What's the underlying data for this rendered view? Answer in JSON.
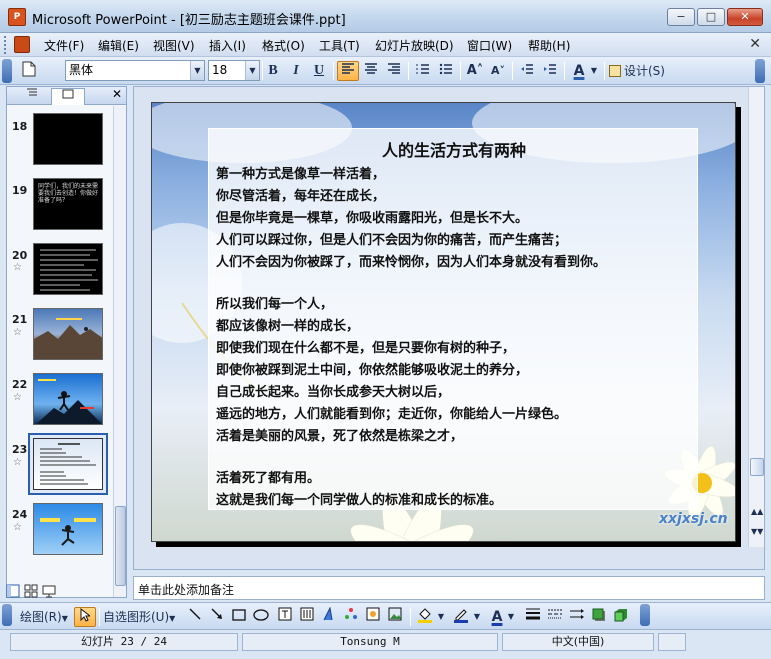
{
  "window": {
    "title": "Microsoft PowerPoint - [初三励志主题班会课件.ppt]",
    "app_icon": "P",
    "controls": {
      "minimize": "−",
      "maximize": "□",
      "close": "✕"
    }
  },
  "menu": {
    "items": [
      "文件(F)",
      "编辑(E)",
      "视图(V)",
      "插入(I)",
      "格式(O)",
      "工具(T)",
      "幻灯片放映(D)",
      "窗口(W)",
      "帮助(H)"
    ],
    "close_doc": "✕"
  },
  "toolbar": {
    "font_name": "黑体",
    "font_size": "18",
    "bold": "B",
    "italic": "I",
    "underline": "U",
    "grow_font": "A˄",
    "shrink_font": "A˅",
    "font_color": "A",
    "design_label": "设计(S)"
  },
  "colors": {
    "accent": "#2a5fb0",
    "active_button": "#ffb347",
    "slide_sky": "#5a86c8"
  },
  "icons": {
    "new": "new-file-icon",
    "align_left": "align-left-icon",
    "align_center": "align-center-icon",
    "align_right": "align-right-icon"
  },
  "left_panel": {
    "tab_outline_icon": "outline-tab-icon",
    "tab_slides_icon": "slides-tab-icon",
    "close": "✕",
    "thumbnails": [
      {
        "num": "18",
        "star": false,
        "style": "black",
        "text": ""
      },
      {
        "num": "19",
        "star": false,
        "style": "black",
        "text": "同学们，我们的未来需要我们去创造！你做好准备了吗？"
      },
      {
        "num": "20",
        "star": true,
        "style": "black-text",
        "text": ""
      },
      {
        "num": "21",
        "star": true,
        "style": "photo-cliff",
        "text": ""
      },
      {
        "num": "22",
        "star": true,
        "style": "photo-sky",
        "text": ""
      },
      {
        "num": "23",
        "star": true,
        "style": "selected",
        "text": ""
      },
      {
        "num": "24",
        "star": true,
        "style": "photo-blue",
        "text": ""
      }
    ]
  },
  "slide": {
    "title": "人的生活方式有两种",
    "lines": [
      "第一种方式是像草一样活着，",
      "你尽管活着，每年还在成长，",
      "但是你毕竟是一棵草，你吸收雨露阳光，但是长不大。",
      "人们可以踩过你，但是人们不会因为你的痛苦，而产生痛苦；",
      "人们不会因为你被踩了，而来怜悯你，因为人们本身就没有看到你。",
      "",
      " 所以我们每一个人，",
      " 都应该像树一样的成长，",
      "即使我们现在什么都不是，但是只要你有树的种子，",
      "即使你被踩到泥土中间，你依然能够吸收泥土的养分，",
      "自己成长起来。当你长成参天大树以后，",
      "遥远的地方，人们就能看到你；走近你，你能给人一片绿色。",
      "活着是美丽的风景，死了依然是栋梁之才，",
      "",
      "活着死了都有用。",
      "这就是我们每一个同学做人的标准和成长的标准。"
    ],
    "watermark": "xxjxsj.cn"
  },
  "notes": {
    "placeholder": "单击此处添加备注"
  },
  "drawing_toolbar": {
    "draw_label": "绘图(R)",
    "autoshapes_label": "自选图形(U)"
  },
  "status": {
    "slide_info": "幻灯片 23 / 24",
    "design": "Tonsung M",
    "language": "中文(中国)"
  }
}
